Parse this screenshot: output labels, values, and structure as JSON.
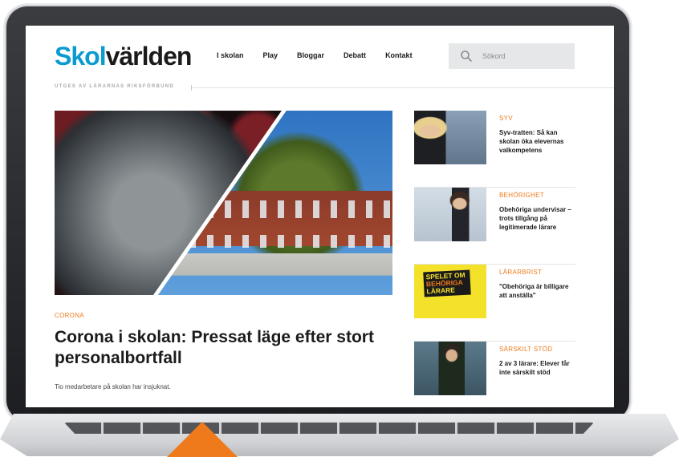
{
  "site": {
    "logo_part1": "Skol",
    "logo_part2": "världen",
    "tagline": "UTGES AV LÄRARNAS RIKSFÖRBUND"
  },
  "nav": {
    "items": [
      "I skolan",
      "Play",
      "Bloggar",
      "Debatt",
      "Kontakt"
    ]
  },
  "search": {
    "placeholder": "Sökord",
    "icon": "search-icon"
  },
  "hero": {
    "category": "CORONA",
    "headline": "Corona i skolan: Pressat läge efter stort personalbortfall",
    "lead": "Tio medarbetare på skolan har insjuknat."
  },
  "sidebar": {
    "items": [
      {
        "category": "SYV",
        "headline": "Syv-tratten: Så kan skolan öka elevernas valkompetens"
      },
      {
        "category": "BEHÖRIGHET",
        "headline": "Obehöriga undervisar – trots tillgång på legitimerade lärare"
      },
      {
        "category": "LÄRARBRIST",
        "headline": "\"Obehöriga är billigare att anställa\"",
        "thumb_text": [
          "SPELET OM",
          "BEHÖRIGA",
          "LÄRARE"
        ]
      },
      {
        "category": "SÄRSKILT STÖD",
        "headline": "2 av 3 lärare: Elever får inte särskilt stöd"
      }
    ]
  },
  "colors": {
    "accent": "#ee7a1b",
    "logo_blue": "#0b9bd1",
    "text_dark": "#1b1b1b",
    "search_bg": "#e6e7e8"
  }
}
